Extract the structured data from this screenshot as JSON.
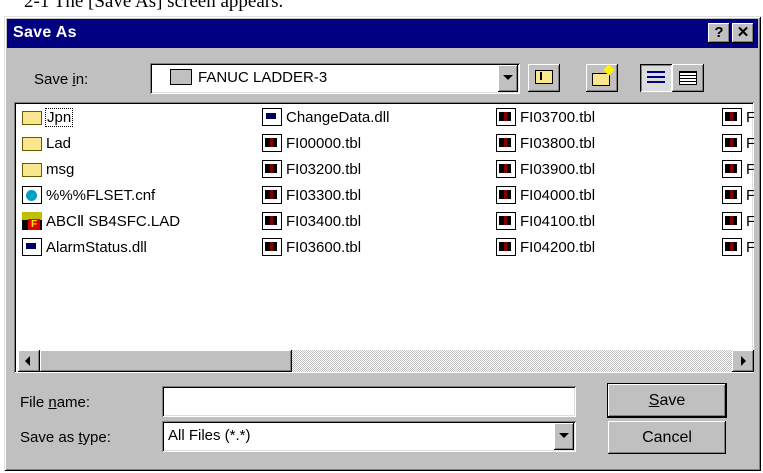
{
  "caption": "2-1   The [Save As] screen appears.",
  "window": {
    "title": "Save As",
    "help_glyph": "?",
    "close_glyph": "✕"
  },
  "save_in": {
    "label_pre": "Save ",
    "label_accel": "i",
    "label_post": "n:",
    "value": "FANUC LADDER-3"
  },
  "files": {
    "col1": [
      {
        "name": "Jpn",
        "icon": "folder-icon"
      },
      {
        "name": "Lad",
        "icon": "folder-icon"
      },
      {
        "name": "msg",
        "icon": "folder-icon"
      },
      {
        "name": "%%%FLSET.cnf",
        "icon": "config-file-icon"
      },
      {
        "name": "ABCⅡ SB4SFC.LAD",
        "icon": "ladder-file-icon"
      },
      {
        "name": "AlarmStatus.dll",
        "icon": "dll-file-icon"
      }
    ],
    "col2": [
      {
        "name": "ChangeData.dll",
        "icon": "dll-file-icon"
      },
      {
        "name": "FI00000.tbl",
        "icon": "tbl-file-icon"
      },
      {
        "name": "FI03200.tbl",
        "icon": "tbl-file-icon"
      },
      {
        "name": "FI03300.tbl",
        "icon": "tbl-file-icon"
      },
      {
        "name": "FI03400.tbl",
        "icon": "tbl-file-icon"
      },
      {
        "name": "FI03600.tbl",
        "icon": "tbl-file-icon"
      }
    ],
    "col3": [
      {
        "name": "FI03700.tbl",
        "icon": "tbl-file-icon"
      },
      {
        "name": "FI03800.tbl",
        "icon": "tbl-file-icon"
      },
      {
        "name": "FI03900.tbl",
        "icon": "tbl-file-icon"
      },
      {
        "name": "FI04000.tbl",
        "icon": "tbl-file-icon"
      },
      {
        "name": "FI04100.tbl",
        "icon": "tbl-file-icon"
      },
      {
        "name": "FI04200.tbl",
        "icon": "tbl-file-icon"
      }
    ],
    "col4_partial": [
      "F",
      "F",
      "F",
      "F",
      "F",
      "F"
    ]
  },
  "file_name": {
    "label_pre": "File ",
    "label_accel": "n",
    "label_post": "ame:",
    "value": ""
  },
  "save_as_type": {
    "label_pre": "Save as ",
    "label_accel": "t",
    "label_post": "ype:",
    "value": "All Files (*.*)"
  },
  "buttons": {
    "save_accel": "S",
    "save_rest": "ave",
    "cancel": "Cancel"
  }
}
